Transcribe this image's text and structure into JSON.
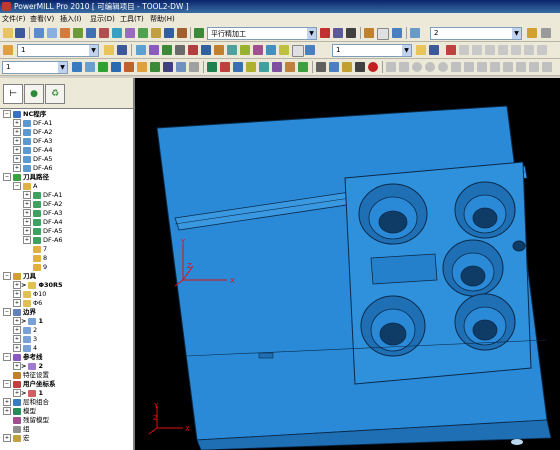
{
  "window": {
    "title": "PowerMILL Pro 2010   [ 可编辑项目 - TOOL2-DW ]"
  },
  "menu": [
    {
      "label": "文件(F)"
    },
    {
      "label": "查看(V)"
    },
    {
      "label": "插入(I)"
    },
    {
      "label": "显示(D)"
    },
    {
      "label": "工具(T)"
    },
    {
      "label": "帮助(H)"
    }
  ],
  "toolbar1": {
    "strategy_label": "平行精加工",
    "tolerance_value": "2"
  },
  "toolbar2": {
    "left_value": "1",
    "mid_value": "1"
  },
  "toolbar3": {
    "left_value": "1"
  },
  "tree": {
    "rows": [
      {
        "label": "NC程序",
        "level": 0,
        "bold": true,
        "toggle": "−",
        "icon": "nc-program-icon"
      },
      {
        "label": "DF-A1",
        "level": 1,
        "toggle": "+",
        "icon": "nc-file-icon"
      },
      {
        "label": "DF-A2",
        "level": 1,
        "toggle": "+",
        "icon": "nc-file-icon"
      },
      {
        "label": "DF-A3",
        "level": 1,
        "toggle": "+",
        "icon": "nc-file-icon"
      },
      {
        "label": "DF-A4",
        "level": 1,
        "toggle": "+",
        "icon": "nc-file-icon"
      },
      {
        "label": "DF-A5",
        "level": 1,
        "toggle": "+",
        "icon": "nc-file-icon"
      },
      {
        "label": "DF-A6",
        "level": 1,
        "toggle": "+",
        "icon": "nc-file-icon"
      },
      {
        "label": "刀具路径",
        "level": 0,
        "bold": true,
        "toggle": "−",
        "icon": "toolpath-icon"
      },
      {
        "label": "A",
        "level": 1,
        "toggle": "−",
        "icon": "folder-icon"
      },
      {
        "label": "DF-A1",
        "level": 2,
        "toggle": "+",
        "icon": "toolpath-item-icon"
      },
      {
        "label": "DF-A2",
        "level": 2,
        "toggle": "+",
        "icon": "toolpath-item-icon"
      },
      {
        "label": "DF-A3",
        "level": 2,
        "toggle": "+",
        "icon": "toolpath-item-icon"
      },
      {
        "label": "DF-A4",
        "level": 2,
        "toggle": "+",
        "icon": "toolpath-item-icon"
      },
      {
        "label": "DF-A5",
        "level": 2,
        "toggle": "+",
        "icon": "toolpath-item-icon"
      },
      {
        "label": "DF-A6",
        "level": 2,
        "toggle": "+",
        "icon": "toolpath-item-icon"
      },
      {
        "label": "7",
        "level": 2,
        "toggle": "",
        "icon": "folder-icon"
      },
      {
        "label": "8",
        "level": 2,
        "toggle": "",
        "icon": "folder-icon"
      },
      {
        "label": "9",
        "level": 2,
        "toggle": "",
        "icon": "folder-icon"
      },
      {
        "label": "刀具",
        "level": 0,
        "bold": true,
        "toggle": "−",
        "icon": "tool-icon"
      },
      {
        "label": "Φ30R5",
        "level": 1,
        "bold": true,
        "toggle": "+",
        "icon": "tool-item-icon",
        "marker": ">"
      },
      {
        "label": "Φ10",
        "level": 1,
        "toggle": "+",
        "icon": "tool-item-icon"
      },
      {
        "label": "Φ6",
        "level": 1,
        "toggle": "+",
        "icon": "tool-item-icon"
      },
      {
        "label": "边界",
        "level": 0,
        "bold": true,
        "toggle": "−",
        "icon": "boundary-icon"
      },
      {
        "label": "1",
        "level": 1,
        "bold": true,
        "toggle": "+",
        "icon": "boundary-item-icon",
        "marker": ">"
      },
      {
        "label": "2",
        "level": 1,
        "toggle": "+",
        "icon": "boundary-item-icon"
      },
      {
        "label": "3",
        "level": 1,
        "toggle": "+",
        "icon": "boundary-item-icon"
      },
      {
        "label": "4",
        "level": 1,
        "toggle": "+",
        "icon": "boundary-item-icon"
      },
      {
        "label": "参考线",
        "level": 0,
        "bold": true,
        "toggle": "−",
        "icon": "pattern-icon"
      },
      {
        "label": "2",
        "level": 1,
        "bold": true,
        "toggle": "+",
        "icon": "pattern-item-icon",
        "marker": ">"
      },
      {
        "label": "特征设置",
        "level": 0,
        "toggle": "",
        "icon": "feature-icon"
      },
      {
        "label": "用户坐标系",
        "level": 0,
        "bold": true,
        "toggle": "−",
        "icon": "workplane-icon"
      },
      {
        "label": "1",
        "level": 1,
        "bold": true,
        "toggle": "+",
        "icon": "workplane-item-icon",
        "marker": ">"
      },
      {
        "label": "层和组合",
        "level": 0,
        "toggle": "+",
        "icon": "layers-icon"
      },
      {
        "label": "模型",
        "level": 0,
        "toggle": "+",
        "icon": "model-icon"
      },
      {
        "label": "残留模型",
        "level": 0,
        "toggle": "",
        "icon": "stock-model-icon"
      },
      {
        "label": "组",
        "level": 0,
        "toggle": "",
        "icon": "group-icon"
      },
      {
        "label": "宏",
        "level": 0,
        "toggle": "+",
        "icon": "macro-icon"
      }
    ]
  },
  "viewport": {
    "axis_labels": {
      "y": "Y",
      "z": "Z",
      "x": "X"
    },
    "colors": {
      "background": "#000000",
      "part": "#2a8ad8",
      "part_edge": "#0a2a4a",
      "accent": "#c03a2b"
    }
  }
}
